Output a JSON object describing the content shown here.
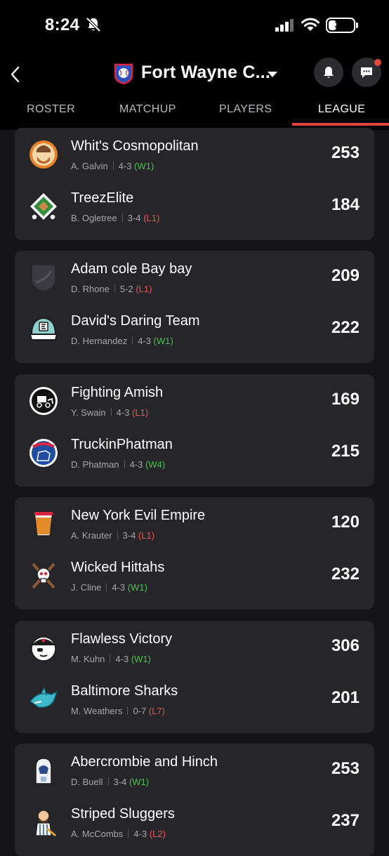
{
  "status_bar": {
    "time": "8:24",
    "battery": "30"
  },
  "header": {
    "league_title": "Fort Wayne C..."
  },
  "tabs": [
    {
      "label": "ROSTER"
    },
    {
      "label": "MATCHUP"
    },
    {
      "label": "PLAYERS"
    },
    {
      "label": "LEAGUE",
      "active": true
    }
  ],
  "matchups": [
    {
      "teams": [
        {
          "name": "Whit's Cosmopolitan",
          "owner": "A. Galvin",
          "record": "4-3",
          "streak": "(W1)",
          "score": "253",
          "icon": "bearded-man-avatar-icon"
        },
        {
          "name": "TreezElite",
          "owner": "B. Ogletree",
          "record": "3-4",
          "streak": "(L1)",
          "score": "184",
          "icon": "baseball-diamond-icon"
        }
      ]
    },
    {
      "teams": [
        {
          "name": "Adam cole Bay bay",
          "owner": "D. Rhone",
          "record": "5-2",
          "streak": "(L1)",
          "score": "209",
          "icon": "default-shield-icon"
        },
        {
          "name": "David's Daring Team",
          "owner": "D. Hernandez",
          "record": "4-3",
          "streak": "(W1)",
          "score": "222",
          "icon": "cap-icon"
        }
      ]
    },
    {
      "teams": [
        {
          "name": "Fighting Amish",
          "owner": "Y. Swain",
          "record": "4-3",
          "streak": "(L1)",
          "score": "169",
          "icon": "amish-buggy-icon"
        },
        {
          "name": "TruckinPhatman",
          "owner": "D. Phatman",
          "record": "4-3",
          "streak": "(W4)",
          "score": "215",
          "icon": "cubs-bear-icon"
        }
      ]
    },
    {
      "teams": [
        {
          "name": "New York Evil Empire",
          "owner": "A. Krauter",
          "record": "3-4",
          "streak": "(L1)",
          "score": "120",
          "icon": "beer-glass-icon"
        },
        {
          "name": "Wicked Hittahs",
          "owner": "J. Cline",
          "record": "4-3",
          "streak": "(W1)",
          "score": "232",
          "icon": "skull-bats-icon"
        }
      ]
    },
    {
      "teams": [
        {
          "name": "Flawless Victory",
          "owner": "M. Kuhn",
          "record": "4-3",
          "streak": "(W1)",
          "score": "306",
          "icon": "pirate-icon"
        },
        {
          "name": "Baltimore Sharks",
          "owner": "M. Weathers",
          "record": "0-7",
          "streak": "(L7)",
          "score": "201",
          "icon": "shark-icon"
        }
      ]
    },
    {
      "teams": [
        {
          "name": "Abercrombie and Hinch",
          "owner": "D. Buell",
          "record": "3-4",
          "streak": "(W1)",
          "score": "253",
          "icon": "hoodie-icon"
        },
        {
          "name": "Striped Sluggers",
          "owner": "A. McCombs",
          "record": "4-3",
          "streak": "(L2)",
          "score": "237",
          "icon": "bearded-player-icon"
        }
      ]
    }
  ],
  "colors": {
    "win": "#4cc04f",
    "loss": "#e35c53",
    "accent": "#e0453d",
    "card": "#25252a"
  }
}
